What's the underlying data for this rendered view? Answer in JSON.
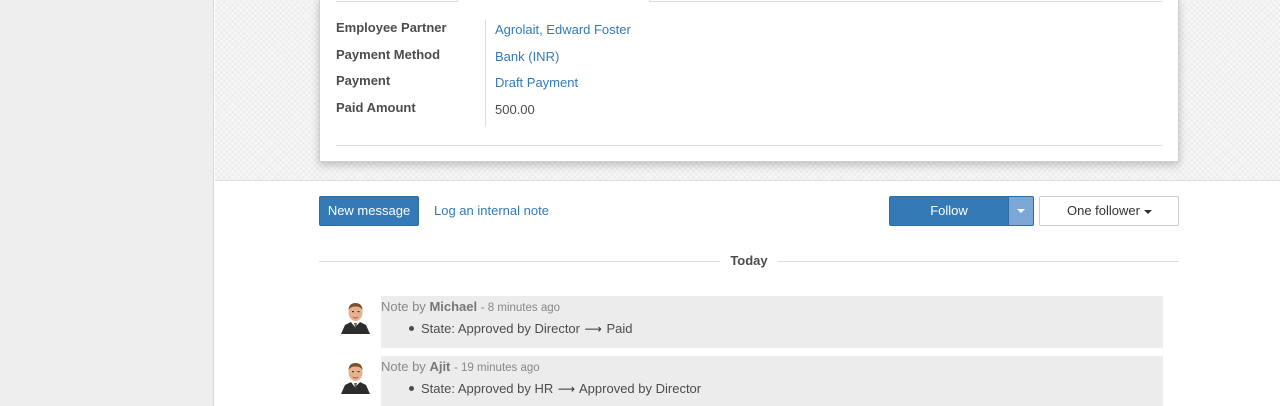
{
  "form": {
    "fields": [
      {
        "label": "Employee Partner",
        "value": "Agrolait, Edward Foster",
        "link": true
      },
      {
        "label": "Payment Method",
        "value": "Bank (INR)",
        "link": true
      },
      {
        "label": "Payment",
        "value": "Draft Payment",
        "link": true
      },
      {
        "label": "Paid Amount",
        "value": "500.00",
        "link": false
      }
    ]
  },
  "chatter": {
    "new_message_label": "New message",
    "log_note_label": "Log an internal note",
    "follow_label": "Follow",
    "followers_label": "One follower",
    "date_separator": "Today",
    "messages": [
      {
        "type": "Note by",
        "author": "Michael",
        "time": "- 8 minutes ago",
        "field": "State:",
        "old": "Approved by Director",
        "new": "Paid"
      },
      {
        "type": "Note by",
        "author": "Ajit",
        "time": "- 19 minutes ago",
        "field": "State:",
        "old": "Approved by HR",
        "new": "Approved by Director"
      }
    ]
  },
  "icons": {
    "dropdown": "chevron-down-icon",
    "arrow": "arrow-right-icon",
    "avatar": "user-avatar-icon"
  },
  "colors": {
    "primary": "#337ab7",
    "link": "#337ab7",
    "message_bg": "#ececec"
  }
}
